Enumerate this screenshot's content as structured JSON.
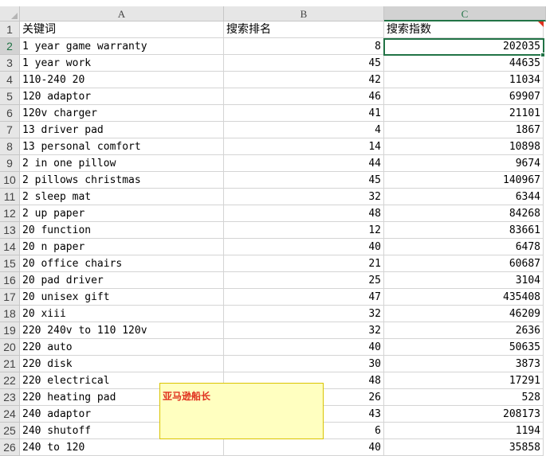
{
  "columns": [
    {
      "letter": "A"
    },
    {
      "letter": "B"
    },
    {
      "letter": "C",
      "selected": true
    }
  ],
  "header_row": {
    "num": "1",
    "a": "关键词",
    "b": "搜索排名",
    "c": "搜索指数"
  },
  "rows": [
    {
      "num": "2",
      "keyword": "1 year game warranty",
      "rank": "8",
      "index": "202035"
    },
    {
      "num": "3",
      "keyword": "1 year work",
      "rank": "45",
      "index": "44635"
    },
    {
      "num": "4",
      "keyword": "110-240 20",
      "rank": "42",
      "index": "11034"
    },
    {
      "num": "5",
      "keyword": "120 adaptor",
      "rank": "46",
      "index": "69907"
    },
    {
      "num": "6",
      "keyword": "120v charger",
      "rank": "41",
      "index": "21101"
    },
    {
      "num": "7",
      "keyword": "13 driver pad",
      "rank": "4",
      "index": "1867"
    },
    {
      "num": "8",
      "keyword": "13 personal comfort",
      "rank": "14",
      "index": "10898"
    },
    {
      "num": "9",
      "keyword": "2 in one pillow",
      "rank": "44",
      "index": "9674"
    },
    {
      "num": "10",
      "keyword": "2 pillows christmas",
      "rank": "45",
      "index": "140967"
    },
    {
      "num": "11",
      "keyword": "2 sleep mat",
      "rank": "32",
      "index": "6344"
    },
    {
      "num": "12",
      "keyword": "2 up paper",
      "rank": "48",
      "index": "84268"
    },
    {
      "num": "13",
      "keyword": "20 function",
      "rank": "12",
      "index": "83661"
    },
    {
      "num": "14",
      "keyword": "20 n paper",
      "rank": "40",
      "index": "6478"
    },
    {
      "num": "15",
      "keyword": "20 office chairs",
      "rank": "21",
      "index": "60687"
    },
    {
      "num": "16",
      "keyword": "20 pad driver",
      "rank": "25",
      "index": "3104"
    },
    {
      "num": "17",
      "keyword": "20 unisex gift",
      "rank": "47",
      "index": "435408"
    },
    {
      "num": "18",
      "keyword": "20 xiii",
      "rank": "32",
      "index": "46209"
    },
    {
      "num": "19",
      "keyword": "220 240v to 110 120v",
      "rank": "32",
      "index": "2636"
    },
    {
      "num": "20",
      "keyword": "220 auto",
      "rank": "40",
      "index": "50635"
    },
    {
      "num": "21",
      "keyword": "220 disk",
      "rank": "30",
      "index": "3873"
    },
    {
      "num": "22",
      "keyword": "220 electrical",
      "rank": "48",
      "index": "17291"
    },
    {
      "num": "23",
      "keyword": "220 heating pad",
      "rank": "26",
      "index": "528"
    },
    {
      "num": "24",
      "keyword": "240 adaptor",
      "rank": "43",
      "index": "208173"
    },
    {
      "num": "25",
      "keyword": "240 shutoff",
      "rank": "6",
      "index": "1194"
    },
    {
      "num": "26",
      "keyword": "240 to 120",
      "rank": "40",
      "index": "35858"
    }
  ],
  "active_cell": "C2",
  "note": {
    "text": "亚马逊船长"
  },
  "colors": {
    "accent": "#217346",
    "comment_marker": "#e0301e",
    "note_bg": "#ffffc0"
  }
}
